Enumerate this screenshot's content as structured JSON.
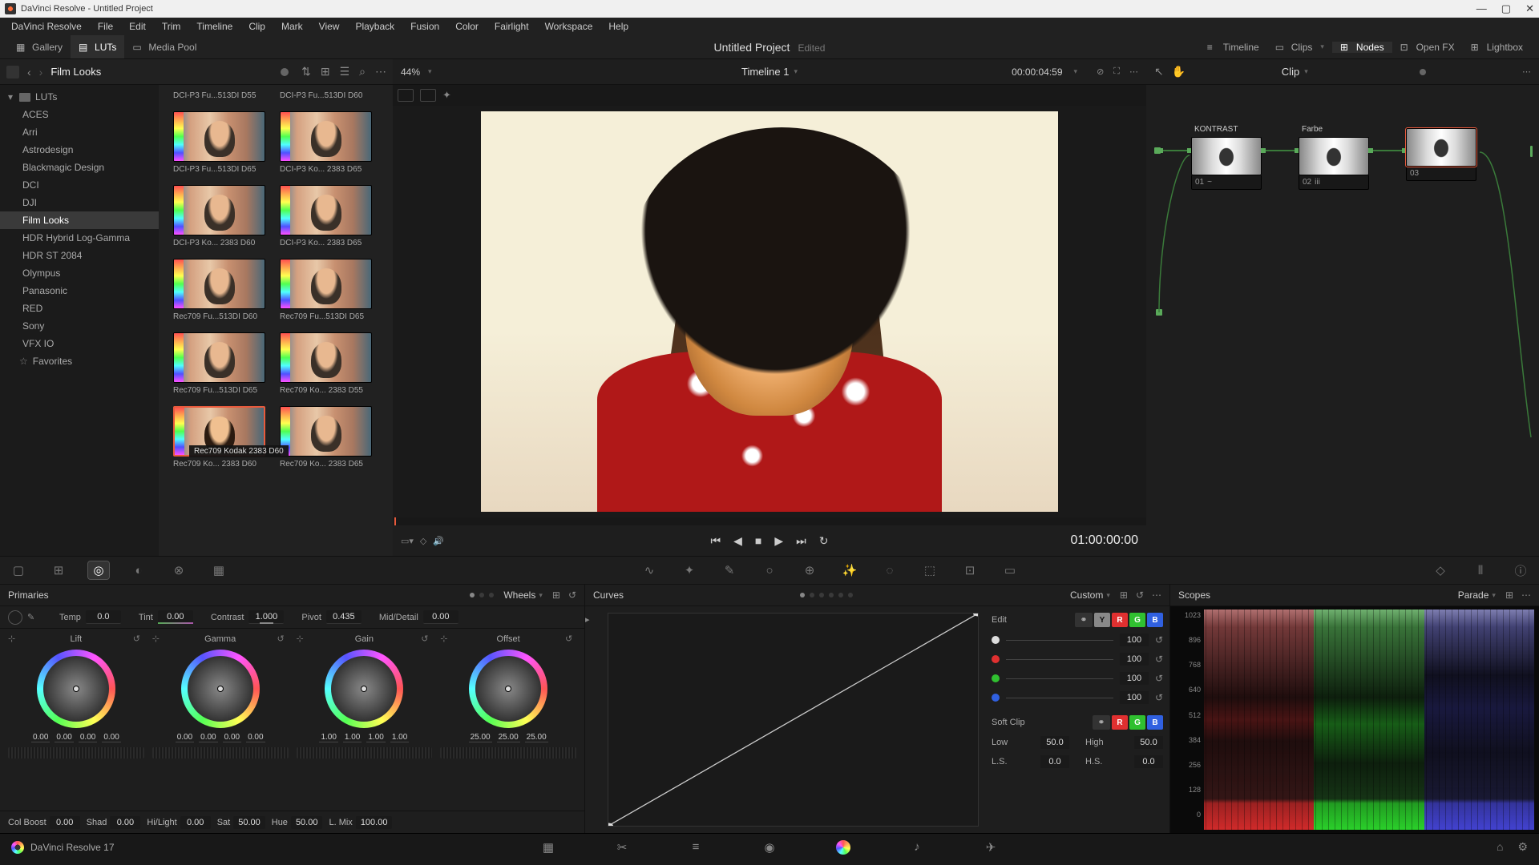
{
  "window": {
    "title": "DaVinci Resolve - Untitled Project"
  },
  "menu": [
    "DaVinci Resolve",
    "File",
    "Edit",
    "Trim",
    "Timeline",
    "Clip",
    "Mark",
    "View",
    "Playback",
    "Fusion",
    "Color",
    "Fairlight",
    "Workspace",
    "Help"
  ],
  "toolbar": {
    "gallery": "Gallery",
    "luts": "LUTs",
    "mediapool": "Media Pool",
    "project_title": "Untitled Project",
    "edited": "Edited",
    "timeline": "Timeline",
    "clips": "Clips",
    "nodes": "Nodes",
    "openfx": "Open FX",
    "lightbox": "Lightbox"
  },
  "lut_panel": {
    "title": "Film Looks",
    "categories": [
      "LUTs",
      "ACES",
      "Arri",
      "Astrodesign",
      "Blackmagic Design",
      "DCI",
      "DJI",
      "Film Looks",
      "HDR Hybrid Log-Gamma",
      "HDR ST 2084",
      "Olympus",
      "Panasonic",
      "RED",
      "Sony",
      "VFX IO",
      "Favorites"
    ],
    "selected_category": "Film Looks",
    "thumbs": [
      {
        "label": "DCI-P3 Fu...513DI D65"
      },
      {
        "label": "DCI-P3 Ko... 2383 D65"
      },
      {
        "label": "DCI-P3 Ko... 2383 D60"
      },
      {
        "label": "DCI-P3 Ko... 2383 D65"
      },
      {
        "label": "Rec709 Fu...513DI D60"
      },
      {
        "label": "Rec709 Fu...513DI D65"
      },
      {
        "label": "Rec709 Fu...513DI D65"
      },
      {
        "label": "Rec709 Ko... 2383 D55"
      },
      {
        "label": "Rec709 Ko... 2383 D60"
      },
      {
        "label": "Rec709 Ko... 2383 D65"
      }
    ],
    "selected_tooltip": "Rec709 Kodak 2383 D60",
    "top_cut": [
      "DCI-P3 Fu...513DI D55",
      "DCI-P3 Fu...513DI D60"
    ]
  },
  "viewer": {
    "zoom": "44%",
    "timeline_name": "Timeline 1",
    "src_tc": "00:00:04:59",
    "rec_tc": "01:00:00:00"
  },
  "nodes": {
    "dropdown": "Clip",
    "items": [
      {
        "num": "01",
        "label": "KONTRAST",
        "badge": "~"
      },
      {
        "num": "02",
        "label": "Farbe",
        "badge": "iii"
      },
      {
        "num": "03",
        "label": "",
        "badge": ""
      }
    ],
    "selected": 2
  },
  "palette_icons": [
    "camera-raw-icon",
    "color-match-icon",
    "primaries-icon",
    "hdr-icon",
    "rgb-mixer-icon",
    "motion-icon",
    "curves-icon",
    "warper-icon",
    "qualifier-icon",
    "window-icon",
    "tracking-icon",
    "magic-mask-icon",
    "blur-icon",
    "key-icon",
    "sizing-icon",
    "3d-icon",
    "keyframe-icon",
    "scopes-icon",
    "info-icon"
  ],
  "primaries": {
    "title": "Primaries",
    "mode": "Wheels",
    "adjust": {
      "temp_lbl": "Temp",
      "temp": "0.0",
      "tint_lbl": "Tint",
      "tint": "0.00",
      "contrast_lbl": "Contrast",
      "contrast": "1.000",
      "pivot_lbl": "Pivot",
      "pivot": "0.435",
      "middetail_lbl": "Mid/Detail",
      "middetail": "0.00"
    },
    "wheels": [
      {
        "name": "Lift",
        "vals": [
          "0.00",
          "0.00",
          "0.00",
          "0.00"
        ]
      },
      {
        "name": "Gamma",
        "vals": [
          "0.00",
          "0.00",
          "0.00",
          "0.00"
        ]
      },
      {
        "name": "Gain",
        "vals": [
          "1.00",
          "1.00",
          "1.00",
          "1.00"
        ]
      },
      {
        "name": "Offset",
        "vals": [
          "25.00",
          "25.00",
          "25.00"
        ]
      }
    ],
    "bottom": {
      "colboost_lbl": "Col Boost",
      "colboost": "0.00",
      "shad_lbl": "Shad",
      "shad": "0.00",
      "hilight_lbl": "Hi/Light",
      "hilight": "0.00",
      "sat_lbl": "Sat",
      "sat": "50.00",
      "hue_lbl": "Hue",
      "hue": "50.00",
      "lmix_lbl": "L. Mix",
      "lmix": "100.00"
    }
  },
  "curves": {
    "title": "Curves",
    "mode": "Custom",
    "edit_lbl": "Edit",
    "channels": {
      "y": "Y",
      "r": "R",
      "g": "G",
      "b": "B"
    },
    "intensity": [
      "100",
      "100",
      "100",
      "100"
    ],
    "softclip_lbl": "Soft Clip",
    "low_lbl": "Low",
    "low": "50.0",
    "high_lbl": "High",
    "high": "50.0",
    "ls_lbl": "L.S.",
    "ls": "0.0",
    "hs_lbl": "H.S.",
    "hs": "0.0"
  },
  "scopes": {
    "title": "Scopes",
    "mode": "Parade",
    "scale": [
      "1023",
      "896",
      "768",
      "640",
      "512",
      "384",
      "256",
      "128",
      "0"
    ]
  },
  "footer": {
    "app": "DaVinci Resolve 17"
  }
}
